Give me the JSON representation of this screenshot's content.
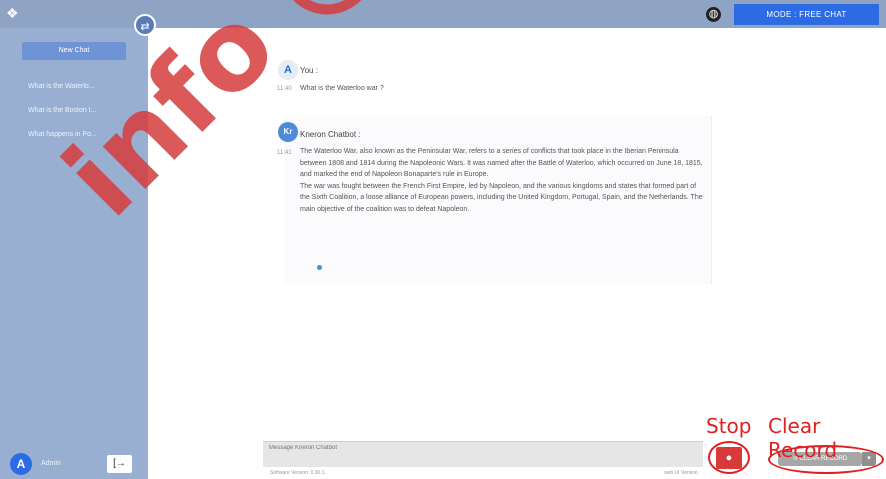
{
  "header": {
    "logo_glyph": "❖",
    "logo_text": "",
    "globe_glyph": "◍",
    "mode_label": "MODE : FREE CHAT",
    "accent": "#2d6be3"
  },
  "sidebar": {
    "new_chat_label": "New Chat",
    "swap_glyph": "⇄",
    "items": [
      {
        "label": "What is the Waterlo..."
      },
      {
        "label": "What is the Boston t..."
      },
      {
        "label": "What happens in Po..."
      }
    ],
    "user": {
      "avatar_letter": "A",
      "name": "Admin"
    },
    "logout_glyph": "[→"
  },
  "messages": {
    "user": {
      "avatar_letter": "A",
      "sender": "You :",
      "time": "11:40",
      "text": "What is the Waterloo war ?"
    },
    "bot": {
      "avatar_letter": "Kr",
      "sender": "Kneron Chatbot :",
      "time": "11:41",
      "paragraph1": "The Waterloo War, also known as the Peninsular War, refers to a series of conflicts that took place in the Iberian Peninsula between 1808 and 1814 during the Napoleonic Wars. It was named after the Battle of Waterloo, which occurred on June 18, 1815, and marked the end of Napoleon Bonaparte's rule in Europe.",
      "paragraph2": "The war was fought between the French First Empire, led by Napoleon, and the various kingdoms and states that formed part of the Sixth Coalition, a loose alliance of European powers, including the United Kingdom, Portugal, Spain, and the Netherlands. The main objective of the coalition was to defeat Napoleon."
    }
  },
  "footer": {
    "input_placeholder": "Message Kneron Chatbot",
    "version_text": "Software Version: 0.30.1",
    "right_text": "web UI Version",
    "stop_glyph": "●",
    "clear_label": "↺ CLEAR RECORD",
    "caret_glyph": "▾"
  },
  "annotations": {
    "stop": "Stop",
    "clear": "Clear Record",
    "color": "#e02020"
  },
  "watermark": "info @"
}
